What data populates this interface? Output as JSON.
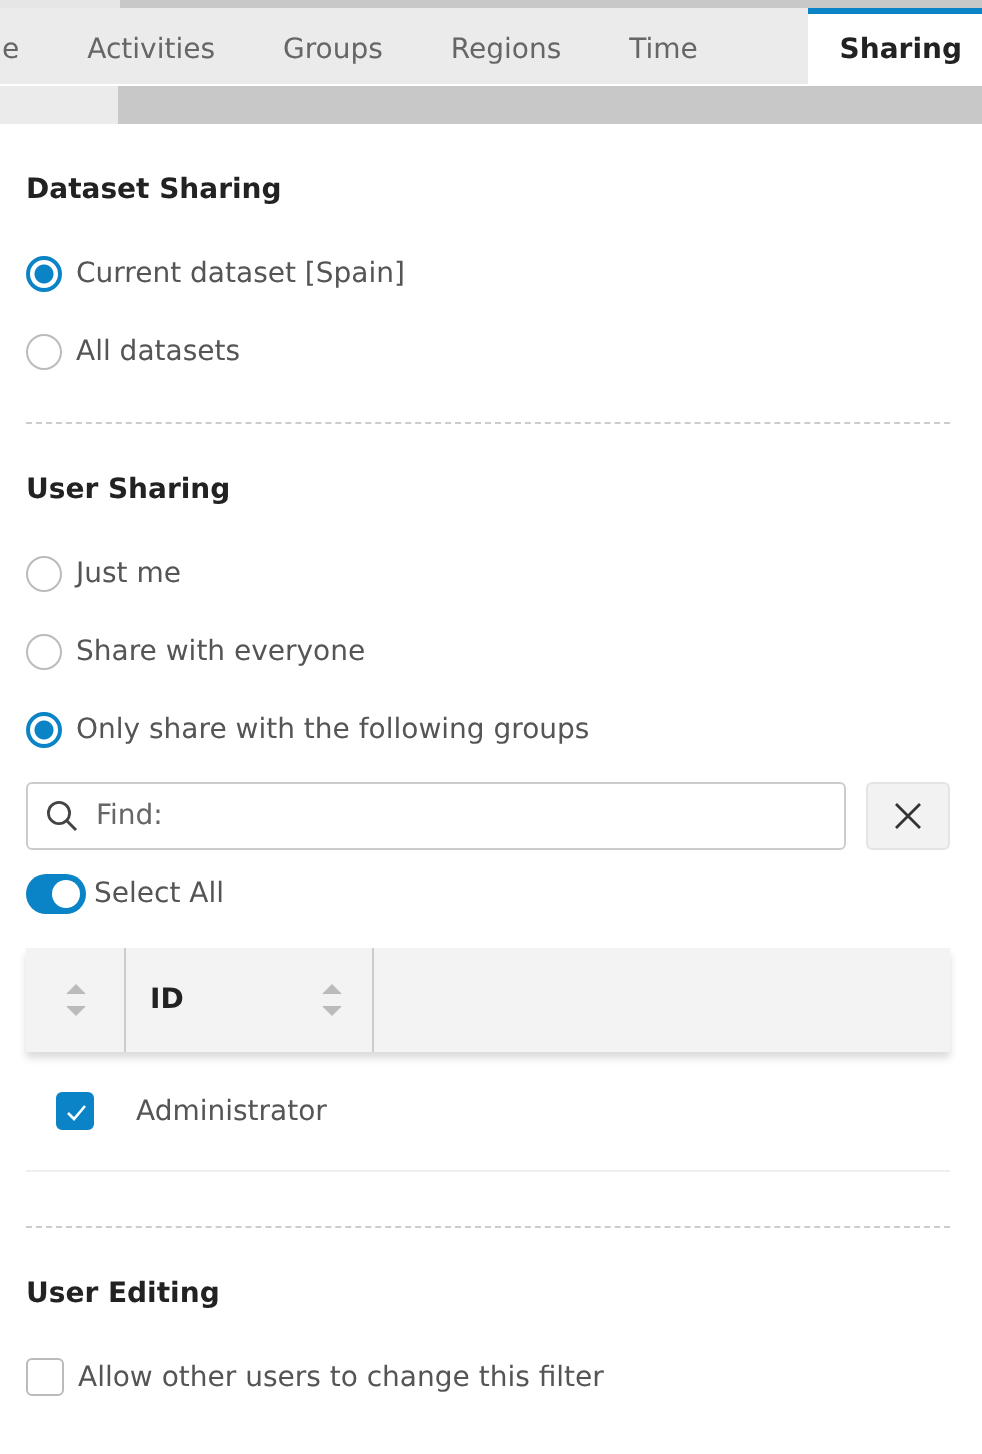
{
  "tabs": [
    {
      "label": "e",
      "selected": false
    },
    {
      "label": "Activities",
      "selected": false
    },
    {
      "label": "Groups",
      "selected": false
    },
    {
      "label": "Regions",
      "selected": false
    },
    {
      "label": "Time",
      "selected": false
    },
    {
      "label": "Sharing",
      "selected": true
    }
  ],
  "dataset_sharing": {
    "title": "Dataset Sharing",
    "options": [
      {
        "label": "Current dataset [Spain]",
        "selected": true
      },
      {
        "label": "All datasets",
        "selected": false
      }
    ]
  },
  "user_sharing": {
    "title": "User Sharing",
    "options": [
      {
        "label": "Just me",
        "selected": false
      },
      {
        "label": "Share with everyone",
        "selected": false
      },
      {
        "label": "Only share with the following groups",
        "selected": true
      }
    ],
    "search": {
      "placeholder": "Find:"
    },
    "select_all": {
      "label": "Select All",
      "on": true
    },
    "table": {
      "columns": [
        {
          "sortable": true
        },
        {
          "label": "ID",
          "sortable": true
        }
      ],
      "rows": [
        {
          "checked": true,
          "id": "Administrator"
        }
      ]
    }
  },
  "user_editing": {
    "title": "User Editing",
    "options": [
      {
        "label": "Allow other users to change this filter",
        "checked": false
      }
    ]
  }
}
